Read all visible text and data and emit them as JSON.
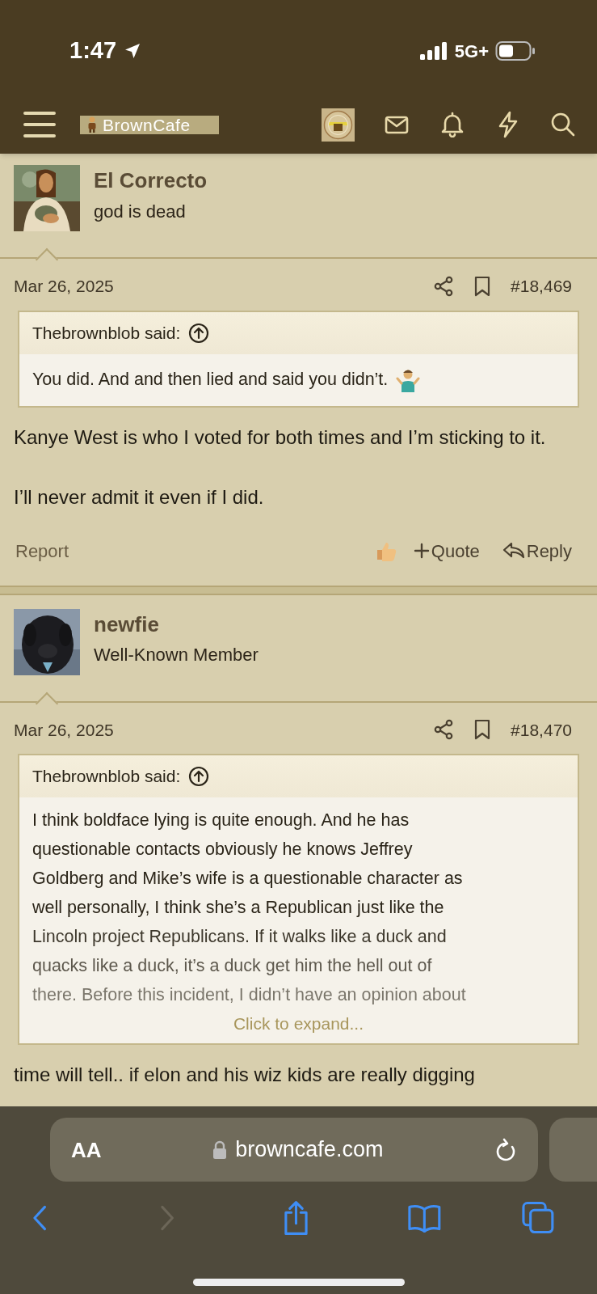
{
  "status_bar": {
    "time": "1:47",
    "network": "5G+"
  },
  "header": {
    "logo_text": "BrownCafe"
  },
  "posts": [
    {
      "author": "El Correcto",
      "user_title": "god is dead",
      "date": "Mar 26, 2025",
      "post_number": "#18,469",
      "quote": {
        "author": "Thebrownblob said:",
        "lines": [
          "You did. And and then lied and said you didn’t."
        ],
        "shrug": true
      },
      "body": [
        "Kanye West is who I voted for both times and I’m sticking to it.",
        "I’ll never admit it even if I did."
      ],
      "actions": {
        "report": "Report",
        "quote": "Quote",
        "reply": "Reply"
      }
    },
    {
      "author": "newfie",
      "user_title": "Well-Known Member",
      "date": "Mar 26, 2025",
      "post_number": "#18,470",
      "quote": {
        "author": "Thebrownblob said:",
        "lines": [
          "I think boldface lying is quite enough. And he has",
          "questionable contacts obviously he knows Jeffrey",
          "Goldberg and Mike’s wife is a questionable character as",
          "well personally, I think she’s a Republican just like the",
          "Lincoln project Republicans. If it walks like a duck and",
          "quacks like a duck, it’s a duck get him the hell out of",
          "there. Before this incident, I didn’t have an opinion about"
        ],
        "shrug": false,
        "expand_label": "Click to expand..."
      },
      "body": [
        "time will tell.. if elon and his wiz kids are really digging"
      ]
    }
  ],
  "browser": {
    "text_size_label": "AA",
    "url": "browncafe.com"
  }
}
